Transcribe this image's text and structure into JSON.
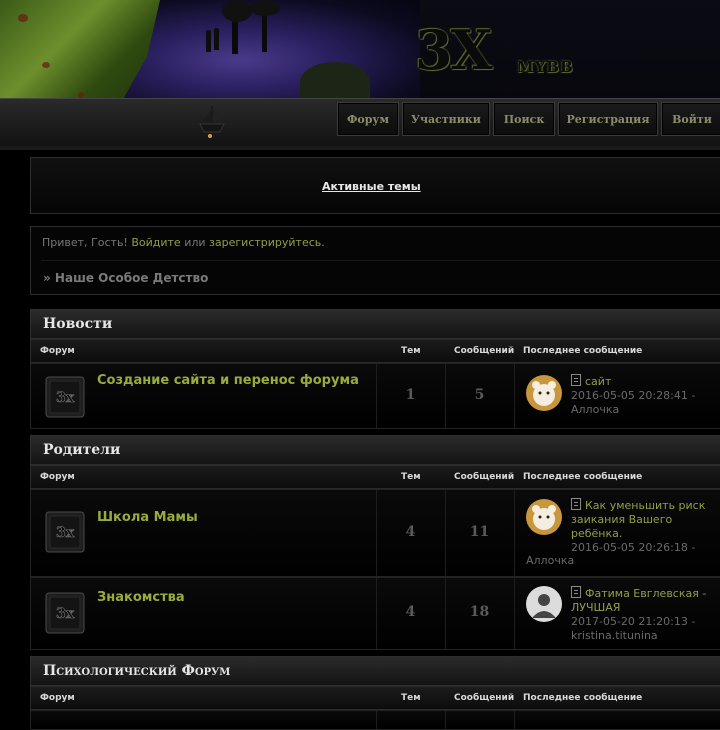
{
  "header": {
    "logo": "3X",
    "logo_sub": "MYBB"
  },
  "nav": [
    "Форум",
    "Участники",
    "Поиск",
    "Регистрация",
    "Войти"
  ],
  "active_topics": "Активные темы",
  "welcome": {
    "greeting": "Привет, Гость!",
    "login": "Войдите",
    "or": "или",
    "register": "зарегистрируйтесь."
  },
  "breadcrumb": "» Наше Особое Детство",
  "columns": {
    "forum": "Форум",
    "topics": "Тем",
    "posts": "Сообщений",
    "last": "Последнее сообщение"
  },
  "categories": [
    {
      "title": "Новости",
      "forums": [
        {
          "name": "Создание сайта и перенос форума",
          "topics": "1",
          "posts": "5",
          "last_title": "сайт",
          "last_date": "2016-05-05 20:28:41 -",
          "last_author": "Аллочка",
          "avatar": "hamster"
        }
      ]
    },
    {
      "title": "Родители",
      "forums": [
        {
          "name": "Школа Мамы",
          "topics": "4",
          "posts": "11",
          "last_title_1": "Как уменьшить риск",
          "last_title_2": "заикания Вашего",
          "last_title_3": "ребёнка.",
          "last_date": "2016-05-05 20:26:18 -",
          "last_author": "Аллочка",
          "avatar": "hamster"
        },
        {
          "name": "Знакомства",
          "topics": "4",
          "posts": "18",
          "last_title_1": "Фатима Евглевская -",
          "last_title_2": "ЛУЧШАЯ",
          "last_date": "2017-05-20 21:20:13 -",
          "last_author": "kristina.titunina",
          "avatar": "user-silhouette"
        }
      ]
    },
    {
      "title": "Психологический Форум",
      "forums": []
    }
  ],
  "colors": {
    "accent_green": "#98ac3e",
    "link_green": "#8fa047",
    "background": "#000000"
  }
}
